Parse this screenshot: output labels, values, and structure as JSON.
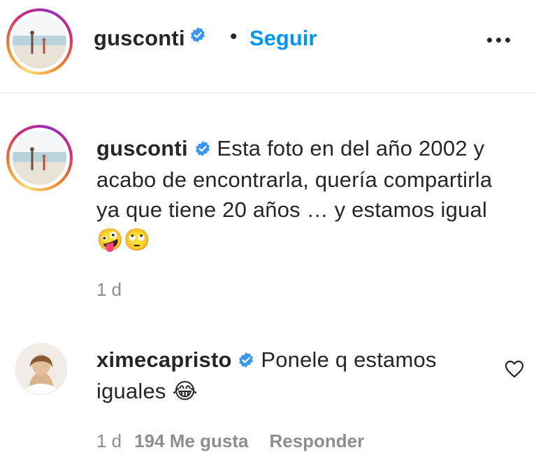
{
  "header": {
    "username": "gusconti",
    "separator": "•",
    "follow_label": "Seguir",
    "more_icon": "more-dots-icon"
  },
  "caption": {
    "username": "gusconti",
    "text": "Esta foto en del año 2002 y acabo de encontrarla, quería compartirla ya que tiene 20 años … y estamos igual",
    "emojis": "🤪🙄",
    "time": "1 d"
  },
  "comment": {
    "username": "ximecapristo",
    "text": "Ponele q estamos iguales",
    "emoji": "😂",
    "time": "1 d",
    "likes": "194 Me gusta",
    "reply_label": "Responder"
  },
  "colors": {
    "link": "#0095f6",
    "verified": "#3897f0",
    "muted": "#8e8e8e",
    "text": "#262626"
  }
}
